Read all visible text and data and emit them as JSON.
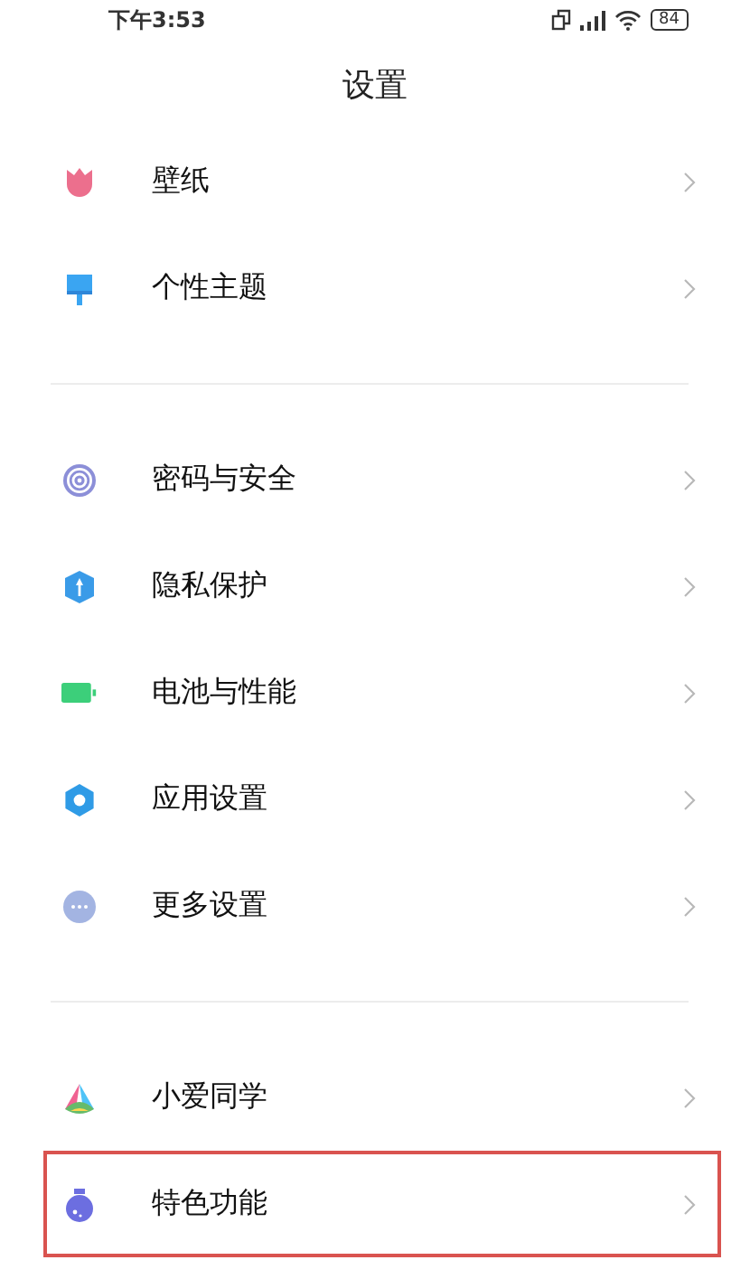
{
  "status_bar": {
    "time": "下午3:53",
    "battery": "84"
  },
  "title": "设置",
  "groups": [
    {
      "items": [
        {
          "label": "壁纸",
          "highlighted": false
        },
        {
          "label": "个性主题",
          "highlighted": false
        }
      ]
    },
    {
      "items": [
        {
          "label": "密码与安全",
          "highlighted": false
        },
        {
          "label": "隐私保护",
          "highlighted": false
        },
        {
          "label": "电池与性能",
          "highlighted": false
        },
        {
          "label": "应用设置",
          "highlighted": false
        },
        {
          "label": "更多设置",
          "highlighted": false
        }
      ]
    },
    {
      "items": [
        {
          "label": "小爱同学",
          "highlighted": false
        },
        {
          "label": "特色功能",
          "highlighted": true
        }
      ]
    }
  ]
}
